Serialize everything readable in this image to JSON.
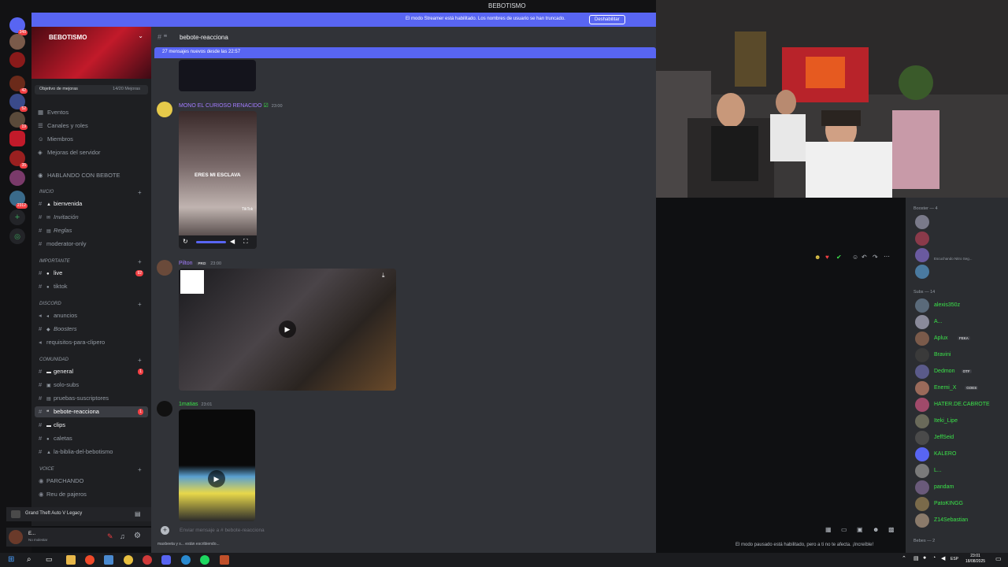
{
  "window": {
    "title": "BEBOTISMO"
  },
  "streamer_banner": {
    "text": "El modo Streamer está habilitado. Los nombres de usuario se han truncado.",
    "button": "Deshabilitar"
  },
  "server": {
    "name": "BEBOTISMO",
    "boost_label": "Objetivo de mejoras",
    "boost_count": "14/20 Mejoras"
  },
  "server_rail": {
    "badges": [
      "348",
      "42",
      "52",
      "19",
      "35",
      "2312"
    ]
  },
  "nav": [
    "Eventos",
    "Canales y roles",
    "Miembros",
    "Mejoras del servidor"
  ],
  "voice_top": "HABLANDO CON BEBOTE",
  "categories": {
    "inicio": "INICIO",
    "importante": "IMPORTANTE",
    "discord": "DISCORD",
    "comunidad": "COMUNIDAD",
    "voice": "VOICE"
  },
  "channels": {
    "inicio": [
      {
        "name": "bienvenida",
        "unread": true
      },
      {
        "name": "Invitación",
        "italic": true
      },
      {
        "name": "Reglas",
        "italic": true
      },
      {
        "name": "moderator-only"
      }
    ],
    "importante": [
      {
        "name": "live",
        "unread": true,
        "badge": "92"
      },
      {
        "name": "tiktok"
      }
    ],
    "discord": [
      {
        "name": "anuncios"
      },
      {
        "name": "Boosters",
        "italic": true
      },
      {
        "name": "requisitos-para-clipero"
      }
    ],
    "comunidad": [
      {
        "name": "general",
        "unread": true,
        "badge": "1"
      },
      {
        "name": "solo-subs"
      },
      {
        "name": "pruebas-suscriptores"
      },
      {
        "name": "bebote-reacciona",
        "selected": true,
        "badge": "1"
      },
      {
        "name": "clips",
        "unread": true
      },
      {
        "name": "caletas"
      },
      {
        "name": "la-biblia-del-bebotismo"
      }
    ],
    "voice": [
      "PARCHANDO",
      "Reu de pajeros"
    ]
  },
  "activity": {
    "game": "Grand Theft Auto V Legacy"
  },
  "user": {
    "name": "E...",
    "status": "No molestar"
  },
  "chat": {
    "channel": "bebote-reacciona",
    "new_messages": "27 mensajes nuevos desde las 22:57",
    "messages": [
      {
        "author": "MONO EL CURIOSO RENACIDO",
        "time": "23:00",
        "video_caption": "ERES MI ESCLAVA",
        "video_sub": "TikTok"
      },
      {
        "author": "Pilton",
        "badge": "PRO",
        "time": "23:00"
      },
      {
        "author": "1matias",
        "time": "23:01"
      }
    ],
    "composer_placeholder": "Enviar mensaje a # bebote-reacciona",
    "typing": "maxbeeta y s... están escribiendo...",
    "paused": "El modo pausado está habilitado, pero a ti no te afecta. ¡Increíble!"
  },
  "members": {
    "boosters": "Booster — 4",
    "subs": "Subs — 14",
    "bebes": "Bebes — 2",
    "booster_status": "Escuchando Nitro Seg...",
    "subs_list": [
      {
        "name": "alexis350z"
      },
      {
        "name": "A..."
      },
      {
        "name": "Aplux",
        "tag": "FEKA"
      },
      {
        "name": "Bravini"
      },
      {
        "name": "Dedmon",
        "tag": "OTF"
      },
      {
        "name": "Enemi_X",
        "tag": "GOES"
      },
      {
        "name": "HATER.DE.CABROTE"
      },
      {
        "name": "Iteki_Lipe"
      },
      {
        "name": "JeffSeid"
      },
      {
        "name": "KALERO"
      },
      {
        "name": "L..."
      },
      {
        "name": "pandam"
      },
      {
        "name": "PatoKINGG"
      },
      {
        "name": "Z14Sebastian"
      }
    ]
  },
  "taskbar": {
    "time": "23:01",
    "date": "18/08/2025",
    "lang": "ESP"
  },
  "colors": {
    "blurple": "#5865f2",
    "sub_green": "#3be34a",
    "red_badge": "#f23f43"
  }
}
